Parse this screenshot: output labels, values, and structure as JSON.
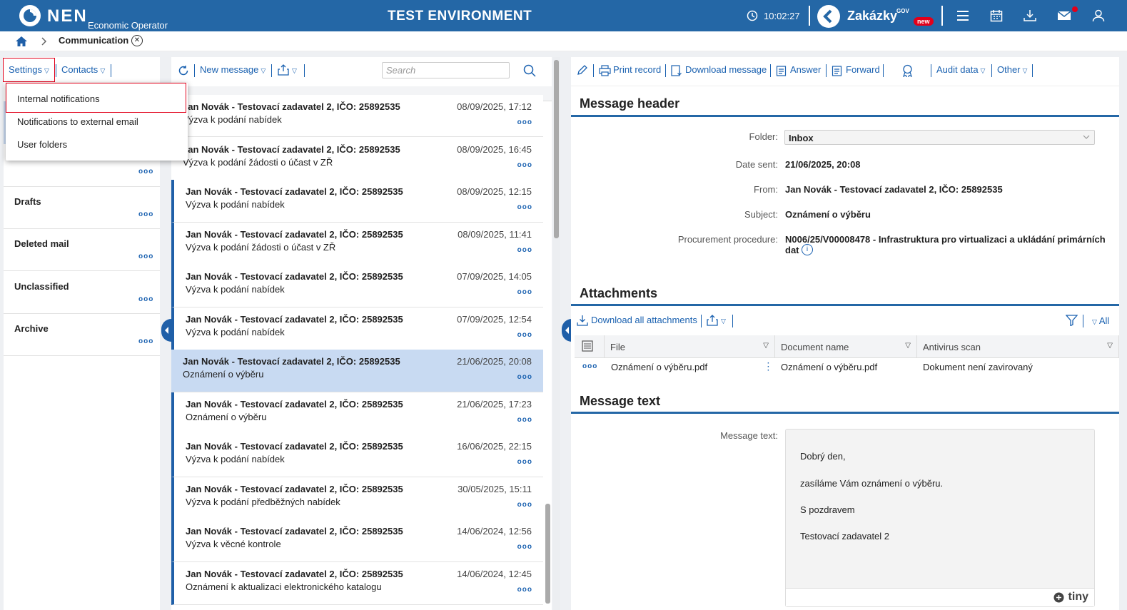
{
  "header": {
    "logo": "NEN",
    "subtitle": "Economic Operator",
    "environment": "TEST ENVIRONMENT",
    "time": "10:02:27",
    "zakazky": "Zakázky",
    "gov": "GOV",
    "new_badge": "new"
  },
  "breadcrumb": {
    "title": "Communication"
  },
  "left": {
    "settings": "Settings",
    "contacts": "Contacts",
    "dropdown": [
      "Internal notifications",
      "Notifications to external email",
      "User folders"
    ],
    "folders": [
      "Drafts",
      "Deleted mail",
      "Unclassified",
      "Archive"
    ]
  },
  "middle": {
    "new_message": "New message",
    "search_placeholder": "Search",
    "messages": [
      {
        "from": "Jan Novák - Testovací zadavatel 2, IČO: 25892535",
        "subject": "Výzva k podání nabídek",
        "date": "08/09/2025, 17:12"
      },
      {
        "from": "Jan Novák - Testovací zadavatel 2, IČO: 25892535",
        "subject": "Výzva k podání žádosti o účast v ZŘ",
        "date": "08/09/2025, 16:45"
      },
      {
        "from": "Jan Novák - Testovací zadavatel 2, IČO: 25892535",
        "subject": "Výzva k podání nabídek",
        "date": "08/09/2025, 12:15"
      },
      {
        "from": "Jan Novák - Testovací zadavatel 2, IČO: 25892535",
        "subject": "Výzva k podání žádosti o účast v ZŘ",
        "date": "08/09/2025, 11:41"
      },
      {
        "from": "Jan Novák - Testovací zadavatel 2, IČO: 25892535",
        "subject": "Výzva k podání nabídek",
        "date": "07/09/2025, 14:05"
      },
      {
        "from": "Jan Novák - Testovací zadavatel 2, IČO: 25892535",
        "subject": "Výzva k podání nabídek",
        "date": "07/09/2025, 12:54"
      },
      {
        "from": "Jan Novák - Testovací zadavatel 2, IČO: 25892535",
        "subject": "Oznámení o výběru",
        "date": "21/06/2025, 20:08"
      },
      {
        "from": "Jan Novák - Testovací zadavatel 2, IČO: 25892535",
        "subject": "Oznámení o výběru",
        "date": "21/06/2025, 17:23"
      },
      {
        "from": "Jan Novák - Testovací zadavatel 2, IČO: 25892535",
        "subject": "Výzva k podání nabídek",
        "date": "16/06/2025, 22:15"
      },
      {
        "from": "Jan Novák - Testovací zadavatel 2, IČO: 25892535",
        "subject": "Výzva k podání předběžných nabídek",
        "date": "30/05/2025, 15:11"
      },
      {
        "from": "Jan Novák - Testovací zadavatel 2, IČO: 25892535",
        "subject": "Výzva k věcné kontrole",
        "date": "14/06/2024, 12:56"
      },
      {
        "from": "Jan Novák - Testovací zadavatel 2, IČO: 25892535",
        "subject": "Oznámení k aktualizaci elektronického katalogu",
        "date": "14/06/2024, 12:45"
      }
    ]
  },
  "right": {
    "toolbar": {
      "print": "Print record",
      "download": "Download message",
      "answer": "Answer",
      "forward": "Forward",
      "audit": "Audit data",
      "other": "Other"
    },
    "message_header": {
      "title": "Message header",
      "folder_label": "Folder:",
      "folder": "Inbox",
      "date_label": "Date sent:",
      "date": "21/06/2025, 20:08",
      "from_label": "From:",
      "from": "Jan Novák - Testovací zadavatel 2, IČO: 25892535",
      "subject_label": "Subject:",
      "subject": "Oznámení o výběru",
      "procedure_label": "Procurement procedure:",
      "procedure_line1": "N006/25/V00008478 - Infrastruktura pro virtualizaci a ukládání primárních",
      "procedure_line2": "dat"
    },
    "attachments": {
      "title": "Attachments",
      "download_all": "Download all attachments",
      "all": "All",
      "columns": [
        "File",
        "Document name",
        "Antivirus scan"
      ],
      "rows": [
        {
          "file": "Oznámení o výběru.pdf",
          "doc": "Oznámení o výběru.pdf",
          "scan": "Dokument není zavirovaný"
        }
      ]
    },
    "message_text": {
      "title": "Message text",
      "label": "Message text:",
      "lines": [
        "Dobrý den,",
        "zasíláme Vám oznámení o výběru.",
        "S pozdravem",
        "Testovací zadavatel 2"
      ],
      "tiny": "tiny"
    }
  }
}
